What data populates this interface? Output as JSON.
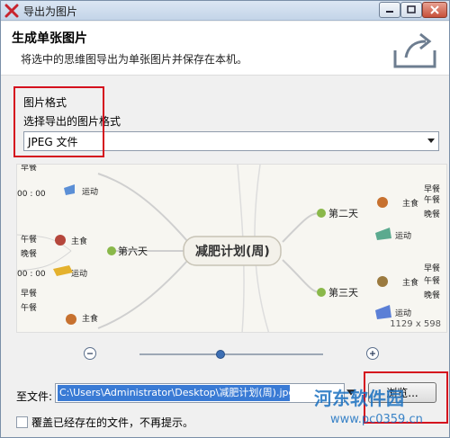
{
  "window": {
    "title": "导出为图片"
  },
  "header": {
    "title": "生成单张图片",
    "description": "将选中的思维图导出为单张图片并保存在本机。"
  },
  "format": {
    "section_label": "图片格式",
    "prompt": "选择导出的图片格式",
    "selected": "JPEG 文件"
  },
  "preview": {
    "root": "减肥计划(周)",
    "branches": [
      "第六天",
      "第二天",
      "第三天"
    ],
    "items": [
      "早餐",
      "午餐",
      "晚餐",
      "运动",
      "主食"
    ],
    "times": [
      "00 : 00",
      "00 : 00",
      "00 : 00"
    ],
    "size": "1129 x 598"
  },
  "zoom": {
    "level": 0.44,
    "minus_icon": "zoom-out-icon",
    "plus_icon": "zoom-in-icon"
  },
  "destination": {
    "label": "至文件:",
    "path": "C:\\Users\\Administrator\\Desktop\\减肥计划(周).jpg",
    "browse_label": "浏览..."
  },
  "overwrite": {
    "label": "覆盖已经存在的文件，不再提示。",
    "checked": false
  },
  "watermark": {
    "title": "河东软件园",
    "url": "www.pc0359.cn"
  },
  "colors": {
    "highlight": "#d5101e",
    "selection": "#3a7bd5",
    "accent": "#3d6fb4"
  }
}
